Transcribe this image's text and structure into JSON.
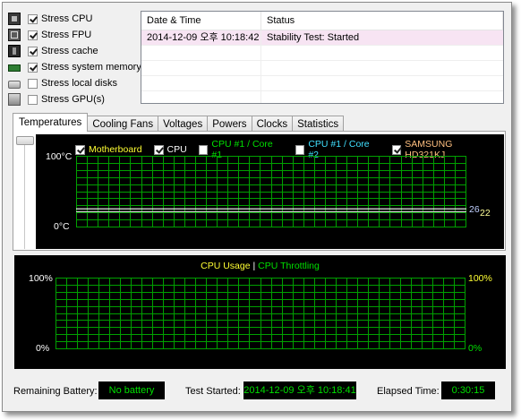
{
  "stress_options": [
    {
      "label": "Stress CPU",
      "checked": true,
      "icon": "cpu-icon"
    },
    {
      "label": "Stress FPU",
      "checked": true,
      "icon": "fpu-icon"
    },
    {
      "label": "Stress cache",
      "checked": true,
      "icon": "cache-icon"
    },
    {
      "label": "Stress system memory",
      "checked": true,
      "icon": "memory-icon"
    },
    {
      "label": "Stress local disks",
      "checked": false,
      "icon": "disk-icon"
    },
    {
      "label": "Stress GPU(s)",
      "checked": false,
      "icon": "gpu-icon"
    }
  ],
  "log": {
    "columns": [
      "Date & Time",
      "Status"
    ],
    "rows": [
      [
        "2014-12-09 오후 10:18:42",
        "Stability Test: Started"
      ]
    ]
  },
  "tabs": [
    "Temperatures",
    "Cooling Fans",
    "Voltages",
    "Powers",
    "Clocks",
    "Statistics"
  ],
  "active_tab": "Temperatures",
  "temp_chart": {
    "legend": [
      {
        "label": "Motherboard",
        "checked": true,
        "color": "#ffff33"
      },
      {
        "label": "CPU",
        "checked": true,
        "color": "#ffffff"
      },
      {
        "label": "CPU #1 / Core #1",
        "checked": false,
        "color": "#00e000"
      },
      {
        "label": "CPU #1 / Core #2",
        "checked": false,
        "color": "#40e0ff"
      },
      {
        "label": "SAMSUNG HD321KJ",
        "checked": true,
        "color": "#ffc080"
      }
    ],
    "y_top_label": "100°C",
    "y_bottom_label": "0°C",
    "ylim": [
      0,
      100
    ],
    "readouts": [
      "26",
      "22"
    ],
    "series": [
      {
        "name": "CPU",
        "color": "#ffffff",
        "value": 26
      },
      {
        "name": "Motherboard",
        "color": "#cfcfcf",
        "value": 22
      }
    ]
  },
  "usage_chart": {
    "title_a": "CPU Usage",
    "separator": "|",
    "title_b": "CPU Throttling",
    "left_top": "100%",
    "left_bottom": "0%",
    "right_top": "100%",
    "right_bottom": "0%",
    "color_a": "#ffff33",
    "color_b": "#00e000"
  },
  "status": {
    "battery_label": "Remaining Battery:",
    "battery_value": "No battery",
    "started_label": "Test Started:",
    "started_value": "2014-12-09 오후 10:18:41",
    "elapsed_label": "Elapsed Time:",
    "elapsed_value": "0:30:15"
  },
  "colors": {
    "grid": "#00a000",
    "value_box_text": "#00e000"
  }
}
